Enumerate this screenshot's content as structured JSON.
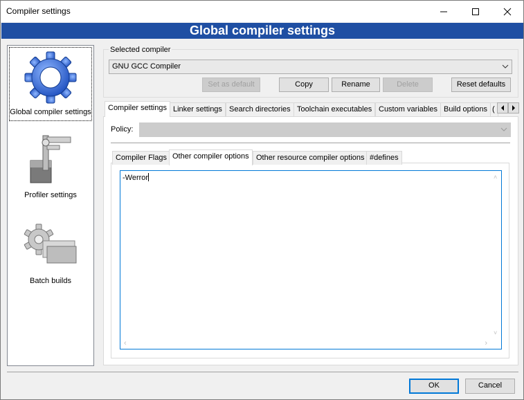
{
  "window": {
    "title": "Compiler settings"
  },
  "banner": {
    "title": "Global compiler settings"
  },
  "sidebar": {
    "items": [
      {
        "label": "Global compiler settings",
        "icon": "gear-icon"
      },
      {
        "label": "Profiler settings",
        "icon": "caliper-icon"
      },
      {
        "label": "Batch builds",
        "icon": "batch-gear-icon"
      }
    ]
  },
  "compiler": {
    "group_label": "Selected compiler",
    "selected": "GNU GCC Compiler",
    "buttons": {
      "set_default": "Set as default",
      "copy": "Copy",
      "rename": "Rename",
      "delete": "Delete",
      "reset": "Reset defaults"
    }
  },
  "tabs": [
    "Compiler settings",
    "Linker settings",
    "Search directories",
    "Toolchain executables",
    "Custom variables",
    "Build options",
    "("
  ],
  "policy": {
    "label": "Policy:",
    "value": ""
  },
  "subtabs": [
    "Compiler Flags",
    "Other compiler options",
    "Other resource compiler options",
    "#defines"
  ],
  "editor": {
    "content": "-Werror"
  },
  "footer": {
    "ok": "OK",
    "cancel": "Cancel"
  },
  "colors": {
    "banner": "#1f4fa3",
    "focus": "#0078d7",
    "accent_blue": "#3a6fd8"
  }
}
